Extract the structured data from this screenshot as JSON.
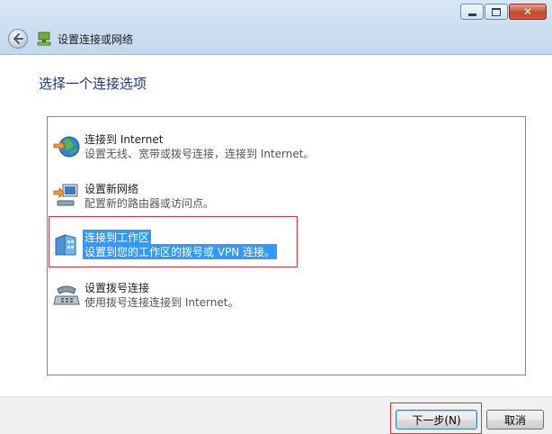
{
  "window": {
    "title": "设置连接或网络",
    "controls": [
      "minimize",
      "maximize",
      "close"
    ]
  },
  "heading": "选择一个连接选项",
  "options": [
    {
      "title": "连接到 Internet",
      "description": "设置无线、宽带或拨号连接，连接到 Internet。",
      "icon": "globe-network-icon",
      "selected": false
    },
    {
      "title": "设置新网络",
      "description": "配置新的路由器或访问点。",
      "icon": "router-computer-icon",
      "selected": false
    },
    {
      "title": "连接到工作区",
      "description": "设置到您的工作区的拨号或 VPN 连接。",
      "icon": "workplace-building-icon",
      "selected": true
    },
    {
      "title": "设置拨号连接",
      "description": "使用拨号连接连接到 Internet。",
      "icon": "telephone-modem-icon",
      "selected": false
    }
  ],
  "buttons": {
    "next": "下一步(N)",
    "cancel": "取消"
  },
  "colors": {
    "heading": "#1e3287",
    "selection": "#3399ff",
    "highlight_box": "#e0323a"
  }
}
